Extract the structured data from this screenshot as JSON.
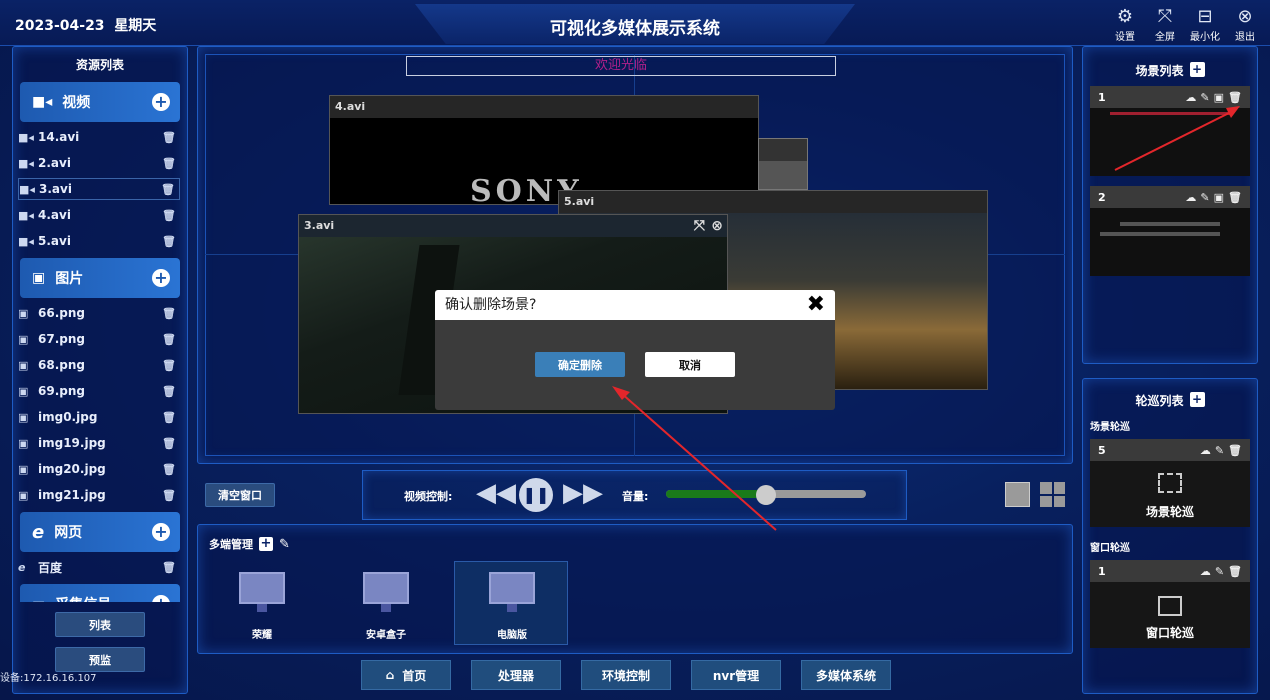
{
  "header": {
    "date": "2023-04-23",
    "weekday": "星期天",
    "title": "可视化多媒体展示系统",
    "settings": "设置",
    "fullscreen": "全屏",
    "minimize": "最小化",
    "exit": "退出"
  },
  "resources": {
    "title": "资源列表",
    "video_label": "视频",
    "videos": [
      "14.avi",
      "2.avi",
      "3.avi",
      "4.avi",
      "5.avi"
    ],
    "image_label": "图片",
    "images": [
      "66.png",
      "67.png",
      "68.png",
      "69.png",
      "img0.jpg",
      "img19.jpg",
      "img20.jpg",
      "img21.jpg"
    ],
    "web_label": "网页",
    "webs": [
      "百度"
    ],
    "capture_label": "采集信号",
    "list_btn": "列表",
    "preview_btn": "预监",
    "device": "设备:172.16.16.107"
  },
  "canvas": {
    "welcome": "欢迎光临",
    "windows": {
      "w4": "4.avi",
      "w5": "5.avi",
      "w3": "3.avi"
    },
    "sony": "SONY"
  },
  "dialog": {
    "title": "确认删除场景?",
    "confirm": "确定删除",
    "cancel": "取消"
  },
  "controls": {
    "clear": "清空窗口",
    "video_ctrl": "视频控制:",
    "volume": "音量:",
    "volume_level": 0.5
  },
  "multi": {
    "title": "多端管理",
    "devices": [
      "荣耀",
      "安卓盒子",
      "电脑版"
    ]
  },
  "scenes": {
    "title": "场景列表",
    "items": [
      "1",
      "2"
    ]
  },
  "tours": {
    "title": "轮巡列表",
    "scene_tour": "场景轮巡",
    "scene_id": "5",
    "scene_tour_label": "场景轮巡",
    "window_tour": "窗口轮巡",
    "window_id": "1",
    "window_tour_label": "窗口轮巡"
  },
  "nav": [
    "首页",
    "处理器",
    "环境控制",
    "nvr管理",
    "多媒体系统"
  ],
  "colors": {
    "accent": "#2a74d4",
    "confirm": "#3a7fb8",
    "welcome": "#b0208a"
  }
}
